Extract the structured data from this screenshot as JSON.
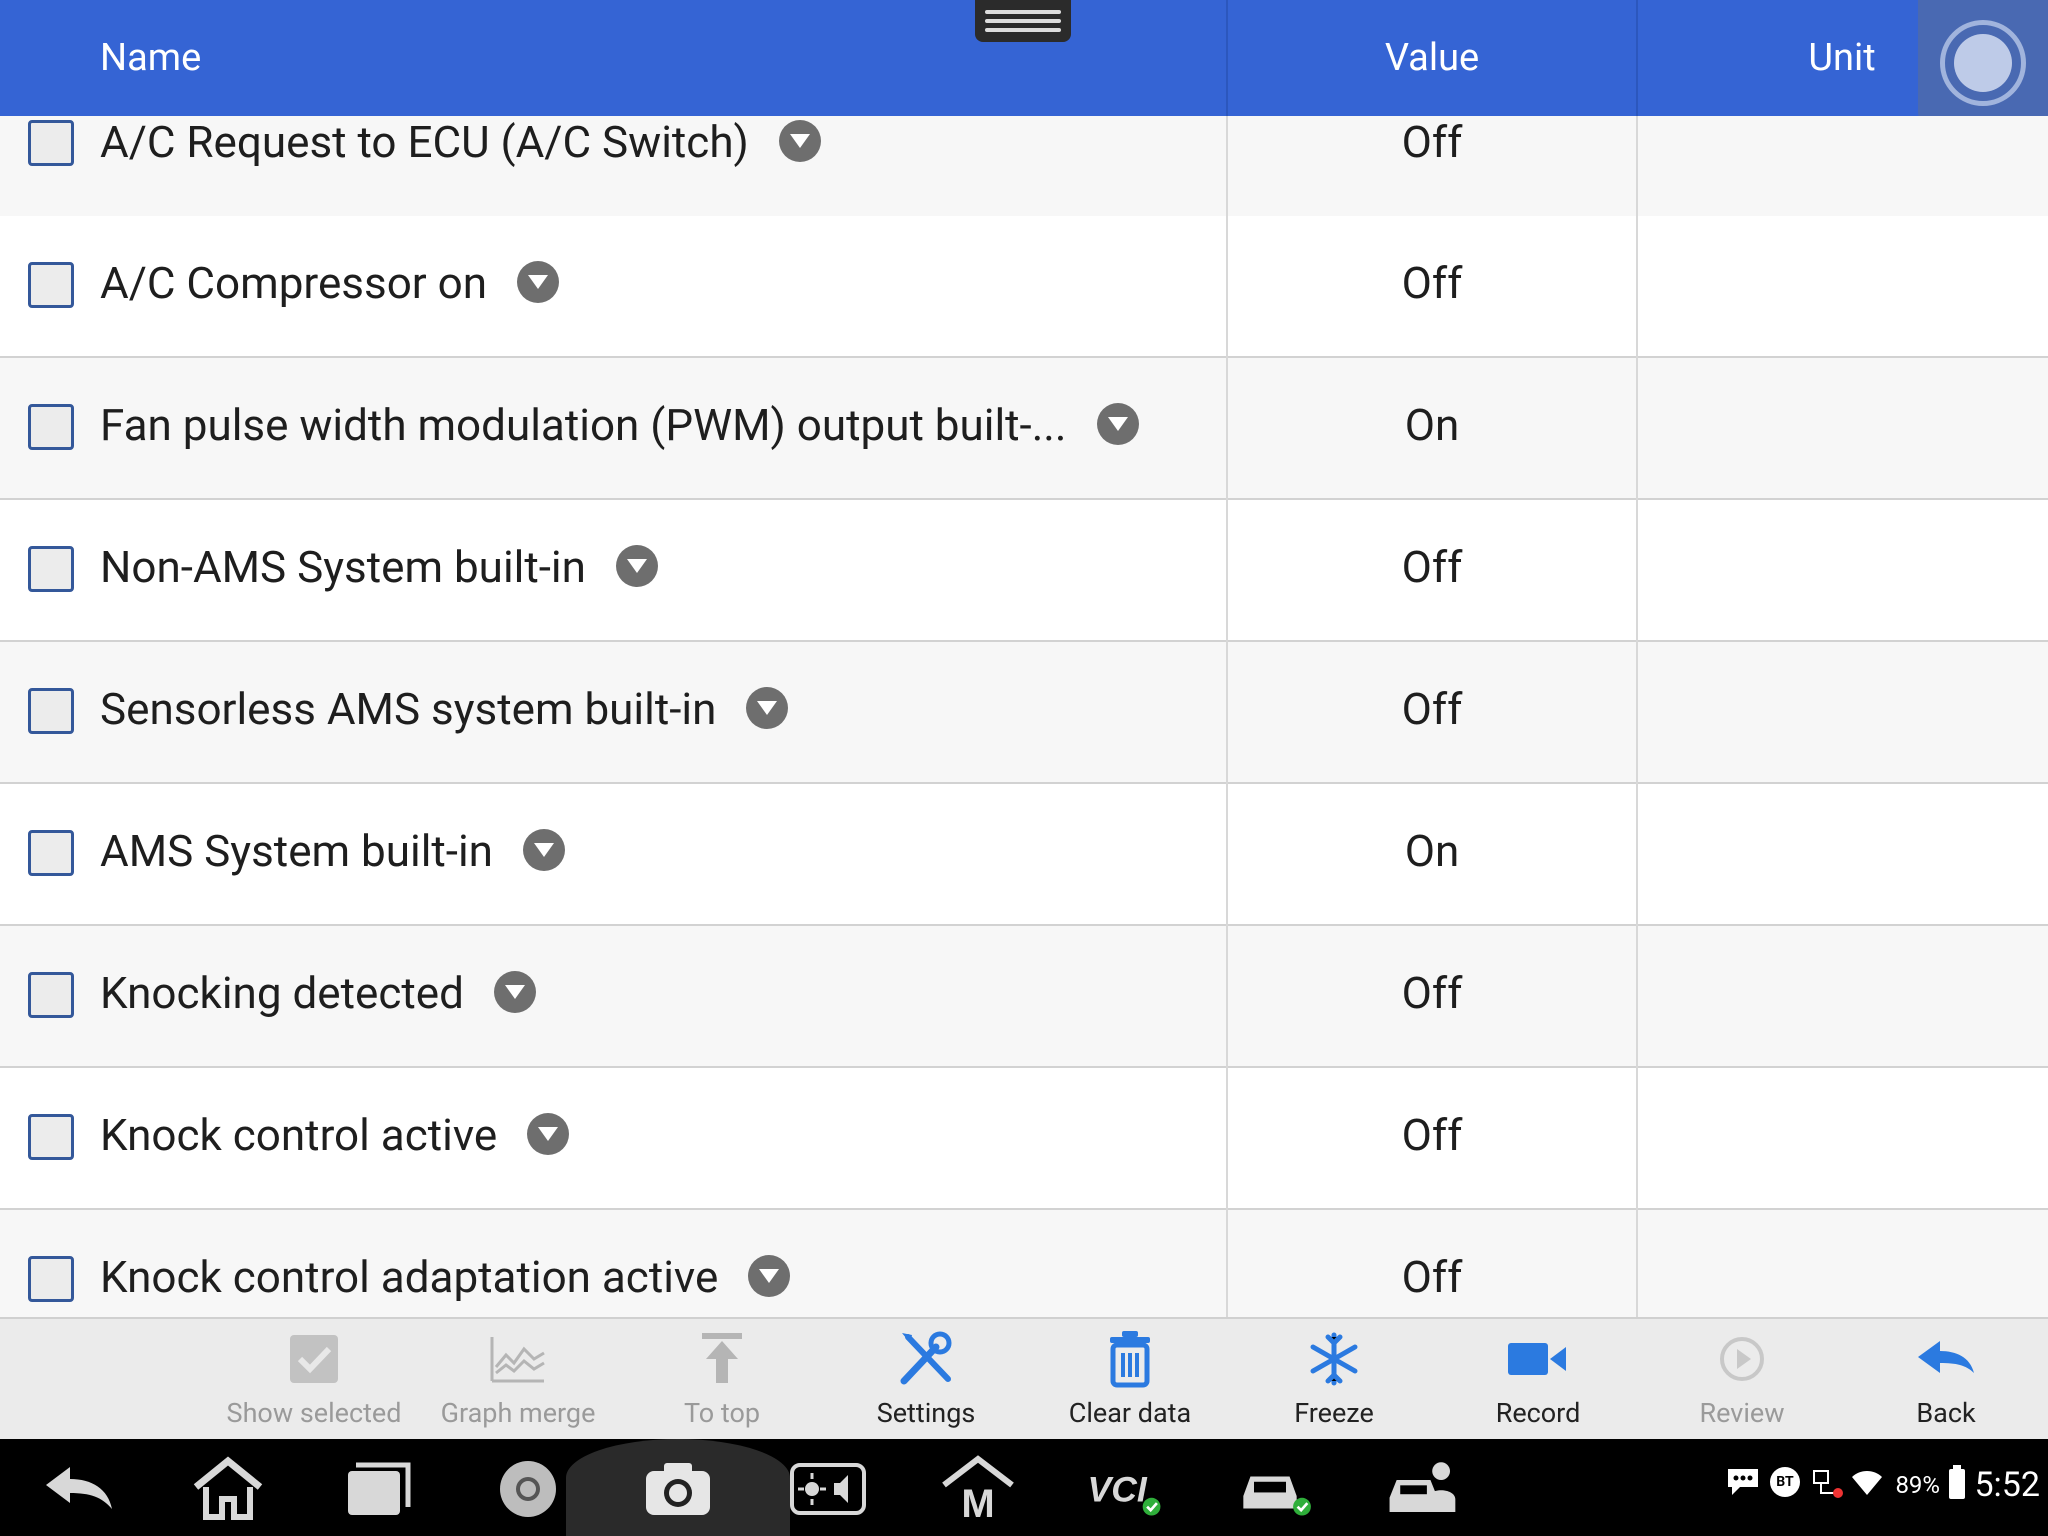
{
  "header": {
    "col_name": "Name",
    "col_value": "Value",
    "col_unit": "Unit"
  },
  "rows": [
    {
      "name": "A/C Request to ECU (A/C Switch)",
      "value": "Off",
      "unit": ""
    },
    {
      "name": "A/C Compressor on",
      "value": "Off",
      "unit": ""
    },
    {
      "name": "Fan pulse width modulation (PWM) output built-...",
      "value": "On",
      "unit": ""
    },
    {
      "name": "Non-AMS System built-in",
      "value": "Off",
      "unit": ""
    },
    {
      "name": "Sensorless AMS system built-in",
      "value": "Off",
      "unit": ""
    },
    {
      "name": "AMS System built-in",
      "value": "On",
      "unit": ""
    },
    {
      "name": "Knocking detected",
      "value": "Off",
      "unit": ""
    },
    {
      "name": "Knock control active",
      "value": "Off",
      "unit": ""
    },
    {
      "name": "Knock control adaptation active",
      "value": "Off",
      "unit": ""
    }
  ],
  "toolbar": {
    "show_selected": "Show selected",
    "graph_merge": "Graph merge",
    "to_top": "To top",
    "settings": "Settings",
    "clear_data": "Clear data",
    "freeze": "Freeze",
    "record": "Record",
    "review": "Review",
    "back": "Back"
  },
  "status_bar": {
    "battery": "89%",
    "time": "5:52",
    "bt_label": "BT"
  },
  "colors": {
    "header_bg": "#3564d4",
    "accent_icon": "#2b7ae0",
    "checkbox_border": "#34589a"
  }
}
